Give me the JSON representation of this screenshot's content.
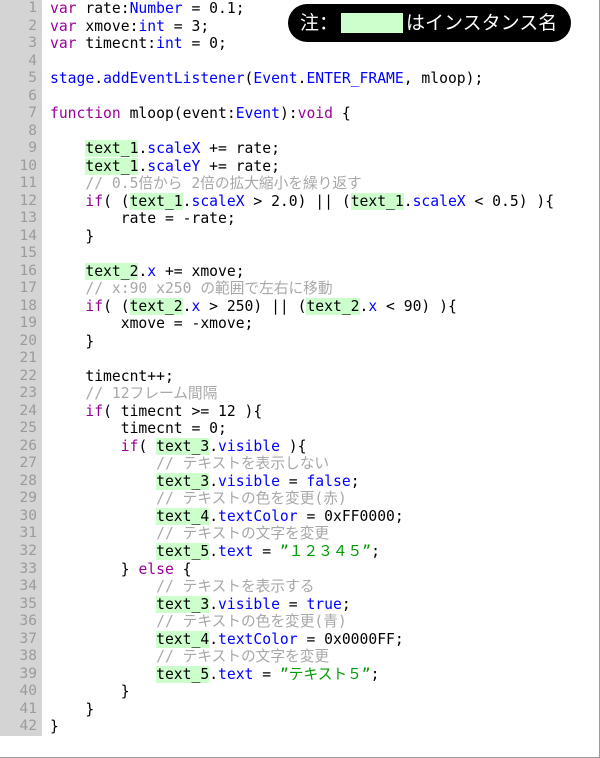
{
  "note": {
    "prefix_label": "注：",
    "swatch_color": "#ccffcc",
    "suffix_label": "はインスタンス名"
  },
  "editor": {
    "gutter_bg": "#d4d4d4",
    "gutter_fg": "#9b9b9b",
    "background": "#ffffff",
    "highlight_color": "#ccffcc",
    "keyword_color": "#9a009a",
    "type_color": "#0000ff",
    "property_color": "#0000ff",
    "string_color": "#009900",
    "comment_color": "#a8a8a8",
    "first_line": 1,
    "last_line": 42,
    "line_numbers": [
      "1",
      "2",
      "3",
      "4",
      "5",
      "6",
      "7",
      "8",
      "9",
      "10",
      "11",
      "12",
      "13",
      "14",
      "15",
      "16",
      "17",
      "18",
      "19",
      "20",
      "21",
      "22",
      "23",
      "24",
      "25",
      "26",
      "27",
      "28",
      "29",
      "30",
      "31",
      "32",
      "33",
      "34",
      "35",
      "36",
      "37",
      "38",
      "39",
      "40",
      "41",
      "42"
    ],
    "lines": [
      {
        "n": "1",
        "tokens": [
          {
            "t": "kw",
            "s": "var"
          },
          {
            "t": "plain",
            "s": " rate:"
          },
          {
            "t": "type",
            "s": "Number"
          },
          {
            "t": "plain",
            "s": " = 0.1;"
          }
        ]
      },
      {
        "n": "2",
        "tokens": [
          {
            "t": "kw",
            "s": "var"
          },
          {
            "t": "plain",
            "s": " xmove:"
          },
          {
            "t": "type",
            "s": "int"
          },
          {
            "t": "plain",
            "s": " = 3;"
          }
        ]
      },
      {
        "n": "3",
        "tokens": [
          {
            "t": "kw",
            "s": "var"
          },
          {
            "t": "plain",
            "s": " timecnt:"
          },
          {
            "t": "type",
            "s": "int"
          },
          {
            "t": "plain",
            "s": " = 0;"
          }
        ]
      },
      {
        "n": "4",
        "tokens": []
      },
      {
        "n": "5",
        "tokens": [
          {
            "t": "type",
            "s": "stage"
          },
          {
            "t": "plain",
            "s": "."
          },
          {
            "t": "prop",
            "s": "addEventListener"
          },
          {
            "t": "plain",
            "s": "("
          },
          {
            "t": "type",
            "s": "Event"
          },
          {
            "t": "plain",
            "s": "."
          },
          {
            "t": "prop",
            "s": "ENTER_FRAME"
          },
          {
            "t": "plain",
            "s": ", mloop);"
          }
        ]
      },
      {
        "n": "6",
        "tokens": []
      },
      {
        "n": "7",
        "tokens": [
          {
            "t": "kw",
            "s": "function"
          },
          {
            "t": "plain",
            "s": " mloop(event:"
          },
          {
            "t": "type",
            "s": "Event"
          },
          {
            "t": "plain",
            "s": "):"
          },
          {
            "t": "kw",
            "s": "void"
          },
          {
            "t": "plain",
            "s": " {"
          }
        ]
      },
      {
        "n": "8",
        "tokens": []
      },
      {
        "n": "9",
        "tokens": [
          {
            "t": "plain",
            "s": "    "
          },
          {
            "t": "inst",
            "s": "text_1"
          },
          {
            "t": "plain",
            "s": "."
          },
          {
            "t": "prop",
            "s": "scaleX"
          },
          {
            "t": "plain",
            "s": " += rate;"
          }
        ]
      },
      {
        "n": "10",
        "tokens": [
          {
            "t": "plain",
            "s": "    "
          },
          {
            "t": "inst",
            "s": "text_1"
          },
          {
            "t": "plain",
            "s": "."
          },
          {
            "t": "prop",
            "s": "scaleY"
          },
          {
            "t": "plain",
            "s": " += rate;"
          }
        ]
      },
      {
        "n": "11",
        "tokens": [
          {
            "t": "plain",
            "s": "    "
          },
          {
            "t": "com",
            "s": "// 0.5倍から 2倍の拡大縮小を繰り返す"
          }
        ]
      },
      {
        "n": "12",
        "tokens": [
          {
            "t": "plain",
            "s": "    "
          },
          {
            "t": "kw",
            "s": "if"
          },
          {
            "t": "plain",
            "s": "( ("
          },
          {
            "t": "inst",
            "s": "text_1"
          },
          {
            "t": "plain",
            "s": "."
          },
          {
            "t": "prop",
            "s": "scaleX"
          },
          {
            "t": "plain",
            "s": " > 2.0) || ("
          },
          {
            "t": "inst",
            "s": "text_1"
          },
          {
            "t": "plain",
            "s": "."
          },
          {
            "t": "prop",
            "s": "scaleX"
          },
          {
            "t": "plain",
            "s": " < 0.5) ){"
          }
        ]
      },
      {
        "n": "13",
        "tokens": [
          {
            "t": "plain",
            "s": "        rate = -rate;"
          }
        ]
      },
      {
        "n": "14",
        "tokens": [
          {
            "t": "plain",
            "s": "    }"
          }
        ]
      },
      {
        "n": "15",
        "tokens": []
      },
      {
        "n": "16",
        "tokens": [
          {
            "t": "plain",
            "s": "    "
          },
          {
            "t": "inst",
            "s": "text_2"
          },
          {
            "t": "plain",
            "s": "."
          },
          {
            "t": "prop",
            "s": "x"
          },
          {
            "t": "plain",
            "s": " += xmove;"
          }
        ]
      },
      {
        "n": "17",
        "tokens": [
          {
            "t": "plain",
            "s": "    "
          },
          {
            "t": "com",
            "s": "// x:90 x250 の範囲で左右に移動"
          }
        ]
      },
      {
        "n": "18",
        "tokens": [
          {
            "t": "plain",
            "s": "    "
          },
          {
            "t": "kw",
            "s": "if"
          },
          {
            "t": "plain",
            "s": "( ("
          },
          {
            "t": "inst",
            "s": "text_2"
          },
          {
            "t": "plain",
            "s": "."
          },
          {
            "t": "prop",
            "s": "x"
          },
          {
            "t": "plain",
            "s": " > 250) || ("
          },
          {
            "t": "inst",
            "s": "text_2"
          },
          {
            "t": "plain",
            "s": "."
          },
          {
            "t": "prop",
            "s": "x"
          },
          {
            "t": "plain",
            "s": " < 90) ){"
          }
        ]
      },
      {
        "n": "19",
        "tokens": [
          {
            "t": "plain",
            "s": "        xmove = -xmove;"
          }
        ]
      },
      {
        "n": "20",
        "tokens": [
          {
            "t": "plain",
            "s": "    }"
          }
        ]
      },
      {
        "n": "21",
        "tokens": []
      },
      {
        "n": "22",
        "tokens": [
          {
            "t": "plain",
            "s": "    timecnt++;"
          }
        ]
      },
      {
        "n": "23",
        "tokens": [
          {
            "t": "plain",
            "s": "    "
          },
          {
            "t": "com",
            "s": "// 12フレーム間隔"
          }
        ]
      },
      {
        "n": "24",
        "tokens": [
          {
            "t": "plain",
            "s": "    "
          },
          {
            "t": "kw",
            "s": "if"
          },
          {
            "t": "plain",
            "s": "( timecnt >= 12 ){"
          }
        ]
      },
      {
        "n": "25",
        "tokens": [
          {
            "t": "plain",
            "s": "        timecnt = 0;"
          }
        ]
      },
      {
        "n": "26",
        "tokens": [
          {
            "t": "plain",
            "s": "        "
          },
          {
            "t": "kw",
            "s": "if"
          },
          {
            "t": "plain",
            "s": "( "
          },
          {
            "t": "inst",
            "s": "text_3"
          },
          {
            "t": "plain",
            "s": "."
          },
          {
            "t": "prop",
            "s": "visible"
          },
          {
            "t": "plain",
            "s": " ){"
          }
        ]
      },
      {
        "n": "27",
        "tokens": [
          {
            "t": "plain",
            "s": "            "
          },
          {
            "t": "com",
            "s": "// テキストを表示しない"
          }
        ]
      },
      {
        "n": "28",
        "tokens": [
          {
            "t": "plain",
            "s": "            "
          },
          {
            "t": "inst",
            "s": "text_3"
          },
          {
            "t": "plain",
            "s": "."
          },
          {
            "t": "prop",
            "s": "visible"
          },
          {
            "t": "plain",
            "s": " = "
          },
          {
            "t": "type",
            "s": "false"
          },
          {
            "t": "plain",
            "s": ";"
          }
        ]
      },
      {
        "n": "29",
        "tokens": [
          {
            "t": "plain",
            "s": "            "
          },
          {
            "t": "com",
            "s": "// テキストの色を変更(赤)"
          }
        ]
      },
      {
        "n": "30",
        "tokens": [
          {
            "t": "plain",
            "s": "            "
          },
          {
            "t": "inst",
            "s": "text_4"
          },
          {
            "t": "plain",
            "s": "."
          },
          {
            "t": "prop",
            "s": "textColor"
          },
          {
            "t": "plain",
            "s": " = 0xFF0000;"
          }
        ]
      },
      {
        "n": "31",
        "tokens": [
          {
            "t": "plain",
            "s": "            "
          },
          {
            "t": "com",
            "s": "// テキストの文字を変更"
          }
        ]
      },
      {
        "n": "32",
        "tokens": [
          {
            "t": "plain",
            "s": "            "
          },
          {
            "t": "inst",
            "s": "text_5"
          },
          {
            "t": "plain",
            "s": "."
          },
          {
            "t": "prop",
            "s": "text"
          },
          {
            "t": "plain",
            "s": " = "
          },
          {
            "t": "str",
            "s": "”１２３４５”"
          },
          {
            "t": "plain",
            "s": ";"
          }
        ]
      },
      {
        "n": "33",
        "tokens": [
          {
            "t": "plain",
            "s": "        } "
          },
          {
            "t": "kw",
            "s": "else"
          },
          {
            "t": "plain",
            "s": " {"
          }
        ]
      },
      {
        "n": "34",
        "tokens": [
          {
            "t": "plain",
            "s": "            "
          },
          {
            "t": "com",
            "s": "// テキストを表示する"
          }
        ]
      },
      {
        "n": "35",
        "tokens": [
          {
            "t": "plain",
            "s": "            "
          },
          {
            "t": "inst",
            "s": "text_3"
          },
          {
            "t": "plain",
            "s": "."
          },
          {
            "t": "prop",
            "s": "visible"
          },
          {
            "t": "plain",
            "s": " = "
          },
          {
            "t": "type",
            "s": "true"
          },
          {
            "t": "plain",
            "s": ";"
          }
        ]
      },
      {
        "n": "36",
        "tokens": [
          {
            "t": "plain",
            "s": "            "
          },
          {
            "t": "com",
            "s": "// テキストの色を変更(青)"
          }
        ]
      },
      {
        "n": "37",
        "tokens": [
          {
            "t": "plain",
            "s": "            "
          },
          {
            "t": "inst",
            "s": "text_4"
          },
          {
            "t": "plain",
            "s": "."
          },
          {
            "t": "prop",
            "s": "textColor"
          },
          {
            "t": "plain",
            "s": " = 0x0000FF;"
          }
        ]
      },
      {
        "n": "38",
        "tokens": [
          {
            "t": "plain",
            "s": "            "
          },
          {
            "t": "com",
            "s": "// テキストの文字を変更"
          }
        ]
      },
      {
        "n": "39",
        "tokens": [
          {
            "t": "plain",
            "s": "            "
          },
          {
            "t": "inst",
            "s": "text_5"
          },
          {
            "t": "plain",
            "s": "."
          },
          {
            "t": "prop",
            "s": "text"
          },
          {
            "t": "plain",
            "s": " = "
          },
          {
            "t": "str",
            "s": "”テキスト５”"
          },
          {
            "t": "plain",
            "s": ";"
          }
        ]
      },
      {
        "n": "40",
        "tokens": [
          {
            "t": "plain",
            "s": "        }"
          }
        ]
      },
      {
        "n": "41",
        "tokens": [
          {
            "t": "plain",
            "s": "    }"
          }
        ]
      },
      {
        "n": "42",
        "tokens": [
          {
            "t": "plain",
            "s": "}"
          }
        ]
      }
    ]
  }
}
